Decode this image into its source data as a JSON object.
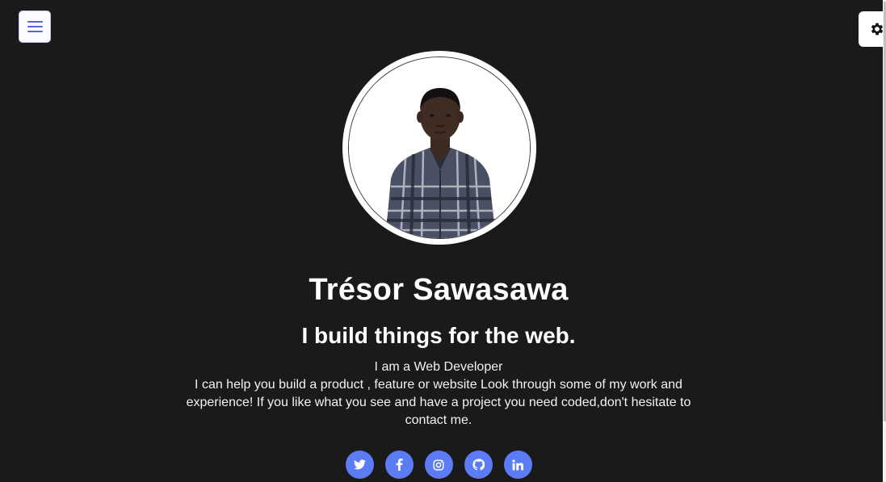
{
  "profile": {
    "name": "Trésor Sawasawa",
    "tagline": "I build things for the web.",
    "role": "I am a Web Developer",
    "bio": "I can help you build a product , feature or website Look through some of my work and experience! If you like what you see and have a project you need coded,don't hesitate to contact me."
  },
  "icons": {
    "menu": "hamburger-menu-icon",
    "settings": "gear-icon",
    "socials": [
      "twitter-icon",
      "facebook-icon",
      "instagram-icon",
      "github-icon",
      "linkedin-icon"
    ]
  },
  "colors": {
    "background": "#1a1a1a",
    "accent": "#5c7cf5",
    "text": "#ffffff"
  }
}
